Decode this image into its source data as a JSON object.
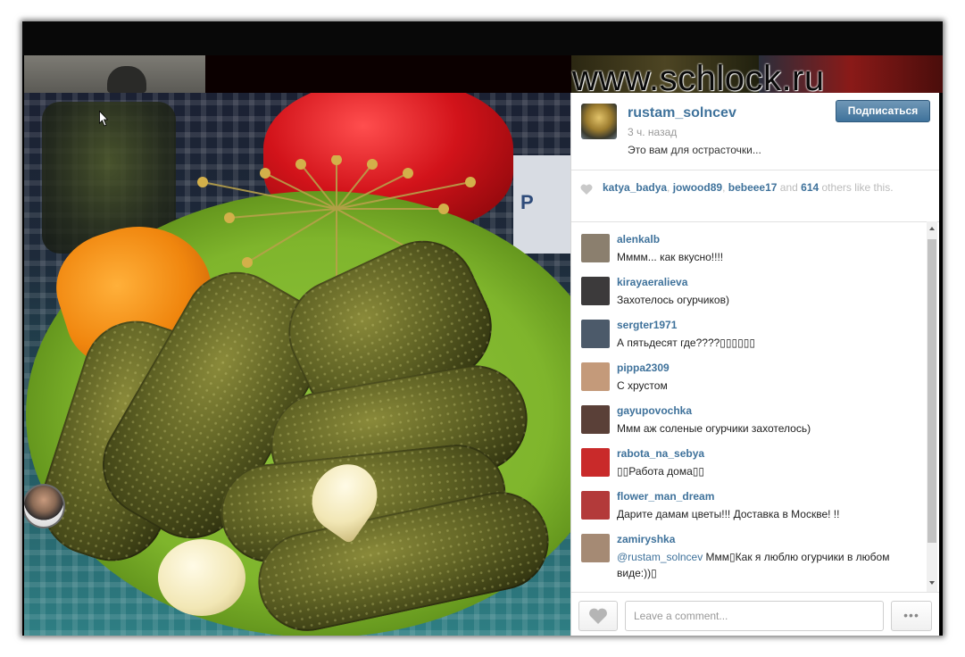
{
  "watermark": "www.schlock.ru",
  "post": {
    "username": "rustam_solncev",
    "time": "3 ч. назад",
    "caption": "Это вам для острасточки...",
    "follow_label": "Подписаться"
  },
  "likes": {
    "users": [
      "katya_badya",
      "jowood89",
      "bebeee17"
    ],
    "sep1": ", ",
    "sep2": ", ",
    "and": " and ",
    "count": "614",
    "others": " others like this."
  },
  "comments": [
    {
      "user": "alenkalb",
      "text": "Мммм... как вкусно!!!!",
      "avatar_color": "#8b7f6e"
    },
    {
      "user": "kirayaeralieva",
      "text": "Захотелось огурчиков)",
      "avatar_color": "#3c3a3b"
    },
    {
      "user": "sergter1971",
      "text": "А пятьдесят где????▯▯▯▯▯▯",
      "avatar_color": "#4c5a6a"
    },
    {
      "user": "pippa2309",
      "text": "С хрустом",
      "avatar_color": "#c49a7a"
    },
    {
      "user": "gayupovochka",
      "text": "Ммм аж соленые огурчики захотелось)",
      "avatar_color": "#5a4038"
    },
    {
      "user": "rabota_na_sebya",
      "text": "▯▯Работа дома▯▯",
      "avatar_color": "#c92a2a"
    },
    {
      "user": "flower_man_dream",
      "text": "Дарите дамам цветы!!! Доставка в Москве! !!",
      "avatar_color": "#b33a3a"
    },
    {
      "user": "zamiryshka",
      "mention": "@rustam_solncev",
      "text": " Ммм▯Как я люблю огурчики в любом виде:))▯",
      "avatar_color": "#a58a74"
    }
  ],
  "comment_input": {
    "placeholder": "Leave a comment..."
  },
  "more_label": "•••",
  "colors": {
    "link": "#3f729b",
    "follow_button": "#3f729b"
  },
  "icons": {
    "like": "heart-icon",
    "more": "ellipsis-icon",
    "cursor": "pointer-cursor-icon"
  }
}
